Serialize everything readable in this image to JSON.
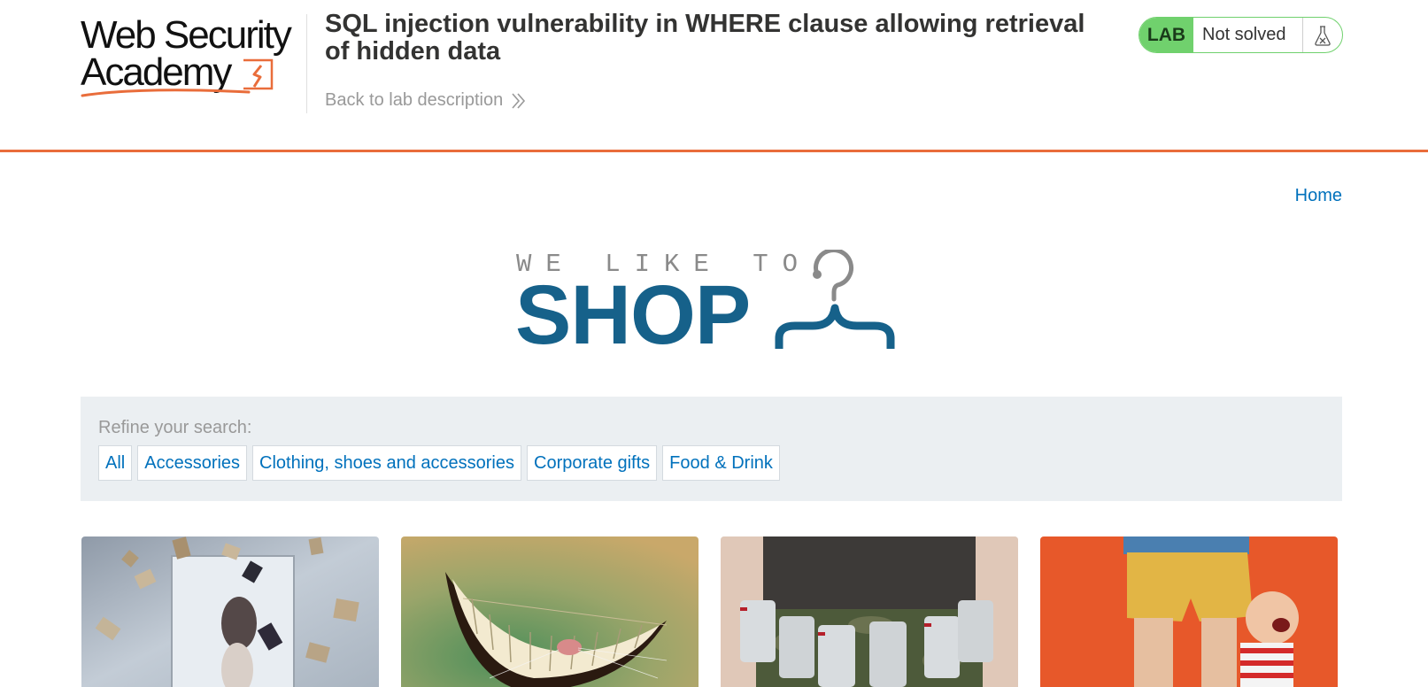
{
  "academy": {
    "logo_line1": "Web Security",
    "logo_line2": "Academy",
    "lab_title": "SQL injection vulnerability in WHERE clause allowing retrieval of hidden data",
    "back_link": "Back to lab description",
    "lab_badge": "LAB",
    "lab_status": "Not solved",
    "icons": {
      "back": "double-chevron-right-icon",
      "flask": "flask-icon"
    },
    "colors": {
      "accent": "#e96d3b",
      "solved_green": "#70d16d"
    }
  },
  "nav": {
    "home": "Home"
  },
  "brand": {
    "tagline": "WE LIKE TO",
    "name": "SHOP",
    "icon": "clothes-hanger-icon",
    "colors": {
      "primary": "#16618a",
      "secondary": "#8a8a8a"
    }
  },
  "filters": {
    "label": "Refine your search:",
    "items": [
      "All",
      "Accessories",
      "Clothing, shoes and accessories",
      "Corporate gifts",
      "Food & Drink"
    ]
  },
  "products": [
    {
      "image": "flying-books-woman-image"
    },
    {
      "image": "cheshire-cat-grin-image"
    },
    {
      "image": "beer-can-belt-image"
    },
    {
      "image": "figurine-child-leg-image"
    }
  ],
  "link_color": "#0071bc"
}
